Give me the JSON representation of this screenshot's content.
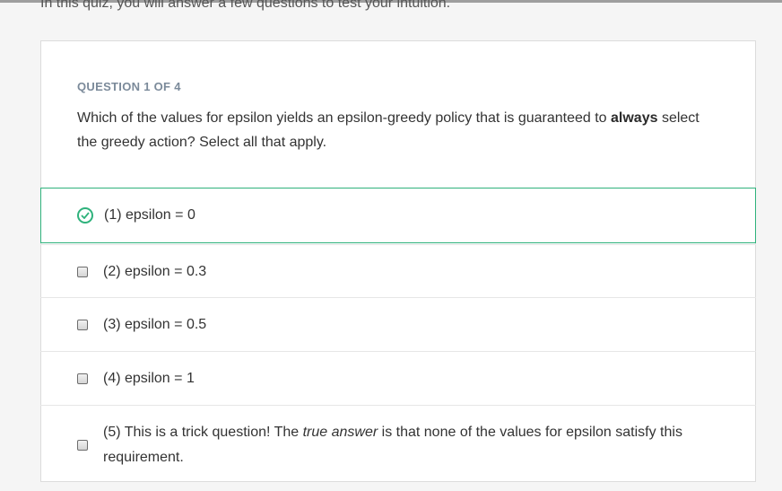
{
  "intro": "In this quiz, you will answer a few questions to test your intuition.",
  "question": {
    "number_label": "QUESTION 1 OF 4",
    "text_before": "Which of the values for epsilon yields an epsilon-greedy policy that is guaranteed to ",
    "text_bold": "always",
    "text_after": " select the greedy action? Select all that apply."
  },
  "options": [
    {
      "label": "(1) epsilon = 0",
      "selected": true
    },
    {
      "label": "(2) epsilon = 0.3",
      "selected": false
    },
    {
      "label": "(3) epsilon = 0.5",
      "selected": false
    },
    {
      "label": "(4) epsilon = 1",
      "selected": false
    },
    {
      "label_before": "(5) This is a trick question! The ",
      "label_italic": "true answer",
      "label_after": " is that none of the values for epsilon satisfy this requirement.",
      "selected": false
    }
  ],
  "colors": {
    "accent": "#2fb27c",
    "question_number": "#7b8a9a"
  }
}
